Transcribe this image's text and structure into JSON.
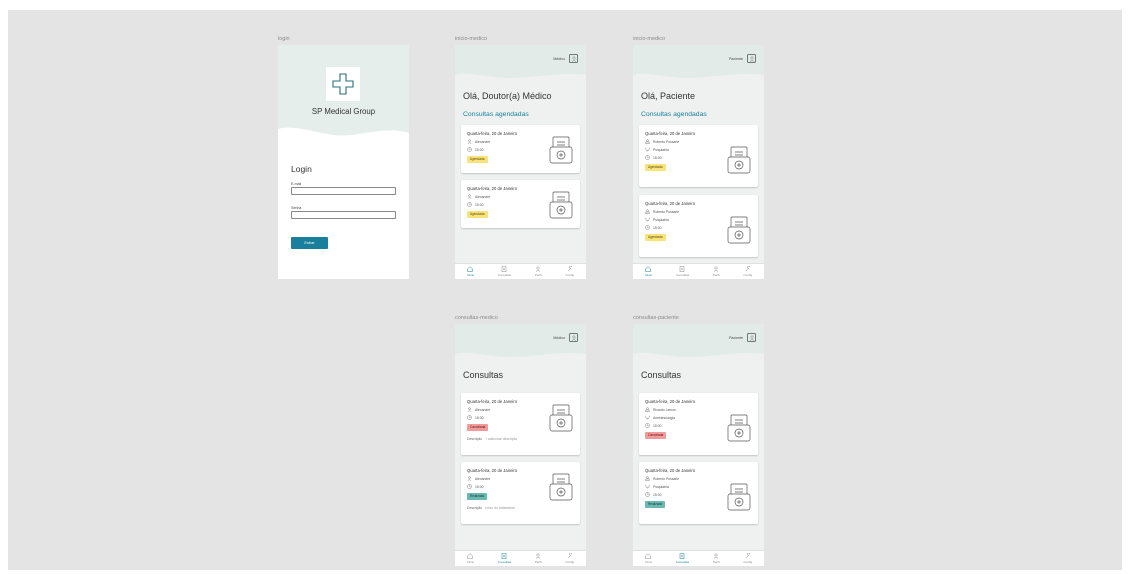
{
  "frames": {
    "login": {
      "label": "login",
      "brand": "SP Medical Group",
      "title": "Login",
      "email_label": "E-mail",
      "password_label": "Senha",
      "submit_label": "Entrar"
    },
    "inicio_medico": {
      "label": "inicio-medico",
      "user": "Médico",
      "greeting": "Olá, Doutor(a) Médico",
      "section": "Consultas agendadas",
      "cards": [
        {
          "date": "Quarta-feira, 20 de Janeiro",
          "person": "Alexandre",
          "time": "15:00",
          "status": "Agendada"
        },
        {
          "date": "Quarta-feira, 20 de Janeiro",
          "person": "Alexandre",
          "time": "15:00",
          "status": "Agendada"
        }
      ]
    },
    "inicio_paciente": {
      "label": "inicio-medico",
      "user": "Paciente",
      "greeting": "Olá, Paciente",
      "section": "Consultas agendadas",
      "cards": [
        {
          "date": "Quarta-feira, 20 de Janeiro",
          "person": "Roberto Possarle",
          "specialty": "Psiquiatria",
          "time": "15:00",
          "status": "Agendada"
        },
        {
          "date": "Quarta-feira, 20 de Janeiro",
          "person": "Roberto Possarle",
          "specialty": "Psiquiatria",
          "time": "15:00",
          "status": "Agendada"
        }
      ]
    },
    "consultas_medico": {
      "label": "consultas-medico",
      "user": "Médico",
      "title": "Consultas",
      "cards": [
        {
          "date": "Quarta-feira, 20 de Janeiro",
          "person": "Alexandre",
          "time": "15:00",
          "status": "Cancelada",
          "desc_label": "Descrição",
          "desc_value": "+ adicionar descrição"
        },
        {
          "date": "Quarta-feira, 20 de Janeiro",
          "person": "Alexandre",
          "time": "15:00",
          "status": "Realizada",
          "desc_label": "Descrição",
          "desc_value": "Início do tratamento"
        }
      ]
    },
    "consultas_paciente": {
      "label": "consultas-paciente",
      "user": "Paciente",
      "title": "Consultas",
      "cards": [
        {
          "date": "Quarta-feira, 20 de Janeiro",
          "person": "Ricardo Lemos",
          "specialty": "Anestesiologia",
          "time": "15:00",
          "status": "Cancelada"
        },
        {
          "date": "Quarta-feira, 20 de Janeiro",
          "person": "Roberto Possarle",
          "specialty": "Psiquiatria",
          "time": "15:00",
          "status": "Realizada"
        }
      ]
    }
  },
  "nav": {
    "home": "Início",
    "consultas": "Consultas",
    "perfil": "Perfil",
    "config": "Config"
  },
  "colors": {
    "accent": "#1a7f9c",
    "agendada": "#f7e27b",
    "cancelada": "#f29b9b",
    "realizada": "#6bb8b0"
  }
}
